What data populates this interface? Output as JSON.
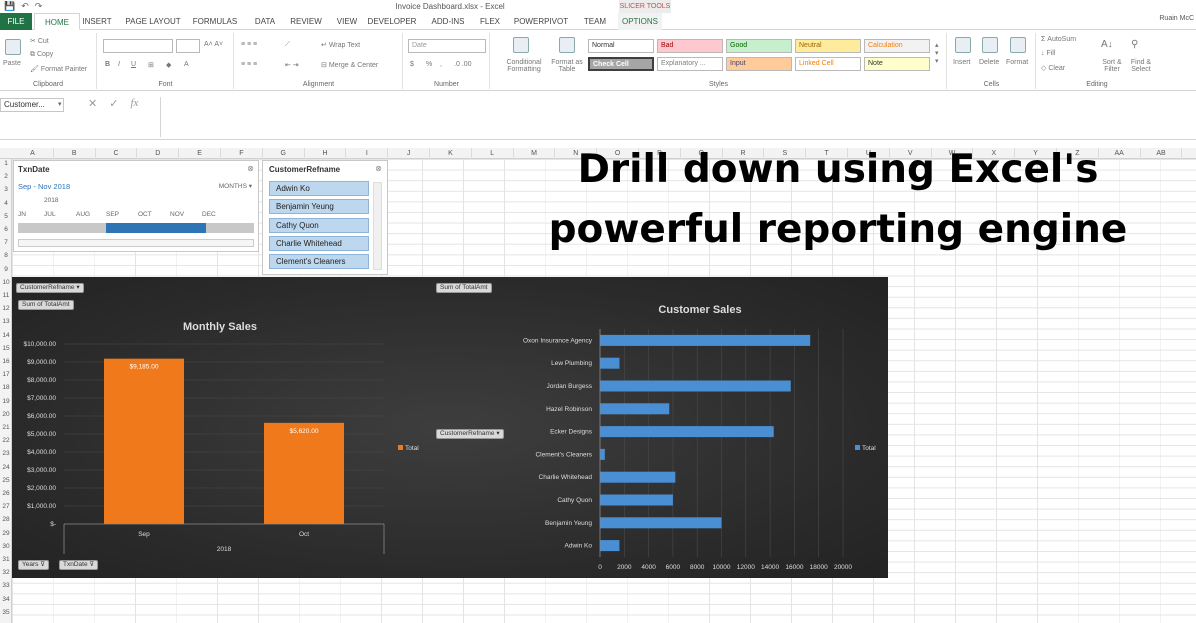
{
  "window": {
    "title": "Invoice Dashboard.xlsx - Excel",
    "context_tab": "SLICER TOOLS",
    "user": "Ruain McC"
  },
  "ribbon_tabs": [
    "FILE",
    "HOME",
    "INSERT",
    "PAGE LAYOUT",
    "FORMULAS",
    "DATA",
    "REVIEW",
    "VIEW",
    "DEVELOPER",
    "ADD-INS",
    "FLEX",
    "POWERPIVOT",
    "TEAM",
    "OPTIONS"
  ],
  "ribbon": {
    "clipboard": {
      "paste": "Paste",
      "cut": "Cut",
      "copy": "Copy",
      "format_painter": "Format Painter",
      "label": "Clipboard"
    },
    "font": {
      "label": "Font",
      "bold": "B",
      "italic": "I",
      "underline": "U"
    },
    "alignment": {
      "wrap": "Wrap Text",
      "merge": "Merge & Center",
      "label": "Alignment"
    },
    "number": {
      "format": "Date",
      "currency": "$",
      "percent": "%",
      "comma": ",",
      "label": "Number"
    },
    "styles": {
      "conditional": "Conditional Formatting",
      "table": "Format as Table",
      "label": "Styles",
      "cells": [
        "Normal",
        "Bad",
        "Good",
        "Neutral",
        "Calculation",
        "Check Cell",
        "Explanatory ...",
        "Input",
        "Linked Cell",
        "Note"
      ]
    },
    "cells": {
      "insert": "Insert",
      "delete": "Delete",
      "format": "Format",
      "label": "Cells"
    },
    "editing": {
      "autosum": "AutoSum",
      "fill": "Fill",
      "clear": "Clear",
      "sort": "Sort & Filter",
      "find": "Find & Select",
      "label": "Editing"
    }
  },
  "formula_bar": {
    "name_box": "Customer...",
    "fx": "fx",
    "cancel": "✕",
    "enter": "✓"
  },
  "columns": [
    "A",
    "B",
    "C",
    "D",
    "E",
    "F",
    "G",
    "H",
    "I",
    "J",
    "K",
    "L",
    "M",
    "N",
    "O",
    "P",
    "Q",
    "R",
    "S",
    "T",
    "U",
    "V",
    "W",
    "X",
    "Y",
    "Z",
    "AA",
    "AB"
  ],
  "rows": [
    "1",
    "2",
    "3",
    "4",
    "5",
    "6",
    "7",
    "8",
    "9",
    "10",
    "11",
    "12",
    "13",
    "14",
    "15",
    "16",
    "17",
    "18",
    "19",
    "20",
    "21",
    "22",
    "23",
    "24",
    "25",
    "26",
    "27",
    "28",
    "29",
    "30",
    "31",
    "32",
    "33",
    "34",
    "35"
  ],
  "timeline": {
    "title": "TxnDate",
    "range": "Sep - Nov 2018",
    "level": "MONTHS",
    "year": "2018",
    "months": [
      "JN",
      "JUL",
      "AUG",
      "SEP",
      "OCT",
      "NOV",
      "DEC"
    ]
  },
  "slicer": {
    "title": "CustomerRefname",
    "items": [
      "Adwin Ko",
      "Benjamin Yeung",
      "Cathy Quon",
      "Charlie Whitehead",
      "Clement's Cleaners"
    ]
  },
  "overlay": {
    "line1": "Drill down using Excel's",
    "line2": "powerful reporting engine"
  },
  "pivot_buttons": {
    "field1": "CustomerRefname",
    "sum1": "Sum of TotalAmt",
    "sum2": "Sum of TotalAmt",
    "field2": "CustomerRefname",
    "years": "Years",
    "txndate": "TxnDate"
  },
  "colors": {
    "bar_orange": "#f07a1b",
    "bar_blue": "#4a8fd4",
    "excel_green": "#217346"
  },
  "chart_data": [
    {
      "type": "bar",
      "title": "Monthly Sales",
      "categories": [
        "Sep",
        "Oct"
      ],
      "group_label": "2018",
      "series": [
        {
          "name": "Total",
          "values": [
            9185,
            5620
          ]
        }
      ],
      "data_labels": [
        "$9,185.00",
        "$5,620.00"
      ],
      "y_ticks": [
        "$10,000.00",
        "$9,000.00",
        "$8,000.00",
        "$7,000.00",
        "$6,000.00",
        "$5,000.00",
        "$4,000.00",
        "$3,000.00",
        "$2,000.00",
        "$1,000.00",
        "$-"
      ],
      "ylim": [
        0,
        10000
      ]
    },
    {
      "type": "bar",
      "orientation": "horizontal",
      "title": "Customer Sales",
      "categories": [
        "Oxon Insurance Agency",
        "Lew Plumbing",
        "Jordan Burgess",
        "Hazel Robinson",
        "Ecker Designs",
        "Clement's Cleaners",
        "Charlie Whitehead",
        "Cathy Quon",
        "Benjamin Yeung",
        "Adwin Ko"
      ],
      "series": [
        {
          "name": "Total",
          "values": [
            17300,
            1600,
            15700,
            5700,
            14300,
            400,
            6200,
            6000,
            10000,
            1600
          ]
        }
      ],
      "x_ticks": [
        "0",
        "2000",
        "4000",
        "6000",
        "8000",
        "10000",
        "12000",
        "14000",
        "16000",
        "18000",
        "20000"
      ],
      "xlim": [
        0,
        20000
      ]
    }
  ]
}
